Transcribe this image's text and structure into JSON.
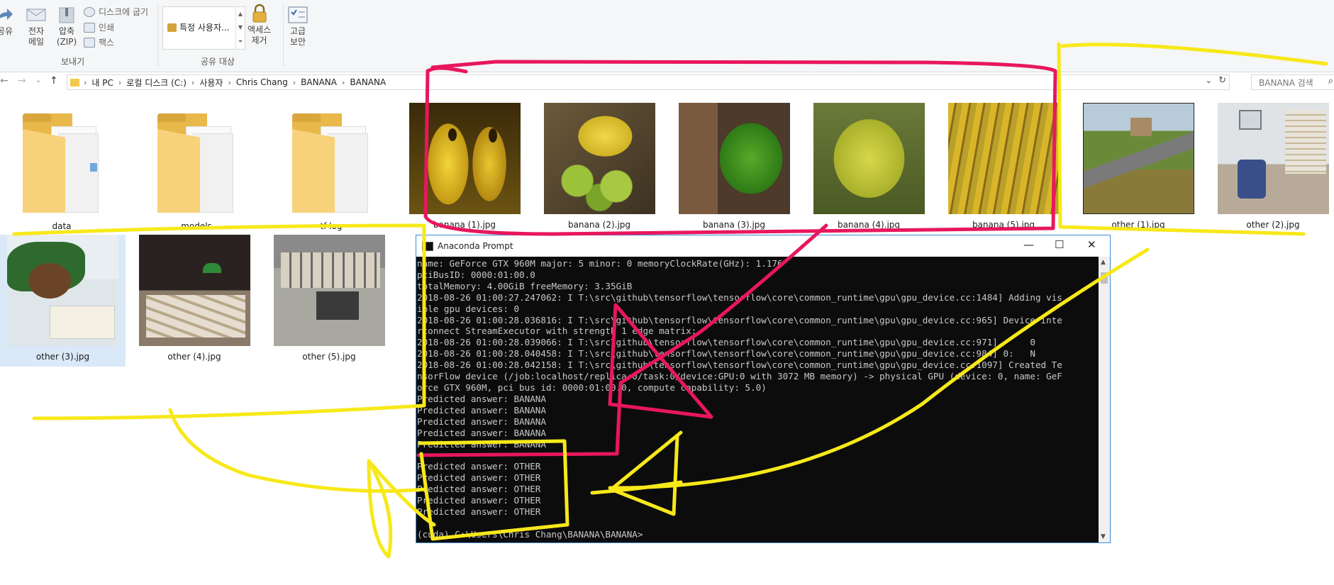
{
  "ribbon": {
    "share": "공유",
    "email": "전자\n메일",
    "zip": "압축\n(ZIP)",
    "burn": "디스크에 굽기",
    "print": "인쇄",
    "fax": "팩스",
    "send_group": "보내기",
    "share_with_item": "특정 사용자...",
    "share_group": "공유 대상",
    "remove_access": "액세스\n제거",
    "advanced_security": "고급\n보안"
  },
  "address": {
    "crumbs": [
      "내 PC",
      "로컬 디스크 (C:)",
      "사용자",
      "Chris Chang",
      "BANANA",
      "BANANA"
    ],
    "search_placeholder": "BANANA 검색"
  },
  "files_row1": [
    {
      "name": "data",
      "kind": "folder"
    },
    {
      "name": "models",
      "kind": "folder"
    },
    {
      "name": "tf-log",
      "kind": "folder"
    },
    {
      "name": "banana (1).jpg",
      "kind": "image",
      "icon": "banana-closeup-photo"
    },
    {
      "name": "banana (2).jpg",
      "kind": "image",
      "icon": "banana-basket-photo"
    },
    {
      "name": "banana (3).jpg",
      "kind": "image",
      "icon": "green-bananas-photo"
    },
    {
      "name": "banana (4).jpg",
      "kind": "image",
      "icon": "small-bananas-photo"
    },
    {
      "name": "banana (5).jpg",
      "kind": "image",
      "icon": "banana-bunches-photo"
    },
    {
      "name": "other (1).jpg",
      "kind": "image",
      "icon": "country-road-photo"
    },
    {
      "name": "other (2).jpg",
      "kind": "image",
      "icon": "office-chair-photo"
    }
  ],
  "files_row2": [
    {
      "name": "other (3).jpg",
      "kind": "image",
      "icon": "sleeping-student-photo"
    },
    {
      "name": "other (4).jpg",
      "kind": "image",
      "icon": "desk-lamp-photo"
    },
    {
      "name": "other (5).jpg",
      "kind": "image",
      "icon": "cluttered-office-photo"
    }
  ],
  "terminal": {
    "title": "Anaconda Prompt",
    "lines": [
      "name: GeForce GTX 960M major: 5 minor: 0 memoryClockRate(GHz): 1.176",
      "pciBusID: 0000:01:00.0",
      "totalMemory: 4.00GiB freeMemory: 3.35GiB",
      "2018-08-26 01:00:27.247062: I T:\\src\\github\\tensorflow\\tensorflow\\core\\common_runtime\\gpu\\gpu_device.cc:1484] Adding vis",
      "ible gpu devices: 0",
      "2018-08-26 01:00:28.036816: I T:\\src\\github\\tensorflow\\tensorflow\\core\\common_runtime\\gpu\\gpu_device.cc:965] Device inte",
      "rconnect StreamExecutor with strength 1 edge matrix:",
      "2018-08-26 01:00:28.039066: I T:\\src\\github\\tensorflow\\tensorflow\\core\\common_runtime\\gpu\\gpu_device.cc:971]      0",
      "2018-08-26 01:00:28.040458: I T:\\src\\github\\tensorflow\\tensorflow\\core\\common_runtime\\gpu\\gpu_device.cc:984] 0:   N",
      "2018-08-26 01:00:28.042158: I T:\\src\\github\\tensorflow\\tensorflow\\core\\common_runtime\\gpu\\gpu_device.cc:1097] Created Te",
      "nsorFlow device (/job:localhost/replica:0/task:0/device:GPU:0 with 3072 MB memory) -> physical GPU (device: 0, name: GeF",
      "orce GTX 960M, pci bus id: 0000:01:00.0, compute capability: 5.0)",
      "Predicted answer: BANANA",
      "Predicted answer: BANANA",
      "Predicted answer: BANANA",
      "Predicted answer: BANANA",
      "Predicted answer: BANANA",
      "",
      "Predicted answer: OTHER",
      "Predicted answer: OTHER",
      "Predicted answer: OTHER",
      "Predicted answer: OTHER",
      "Predicted answer: OTHER",
      "",
      "(cuda) C:\\Users\\Chris Chang\\BANANA\\BANANA>"
    ]
  },
  "colors": {
    "highlight_pink": "#e8175d",
    "highlight_yellow": "#f7e81a",
    "folder_yellow": "#f7d27a",
    "selection_blue": "#d9e9f8"
  }
}
